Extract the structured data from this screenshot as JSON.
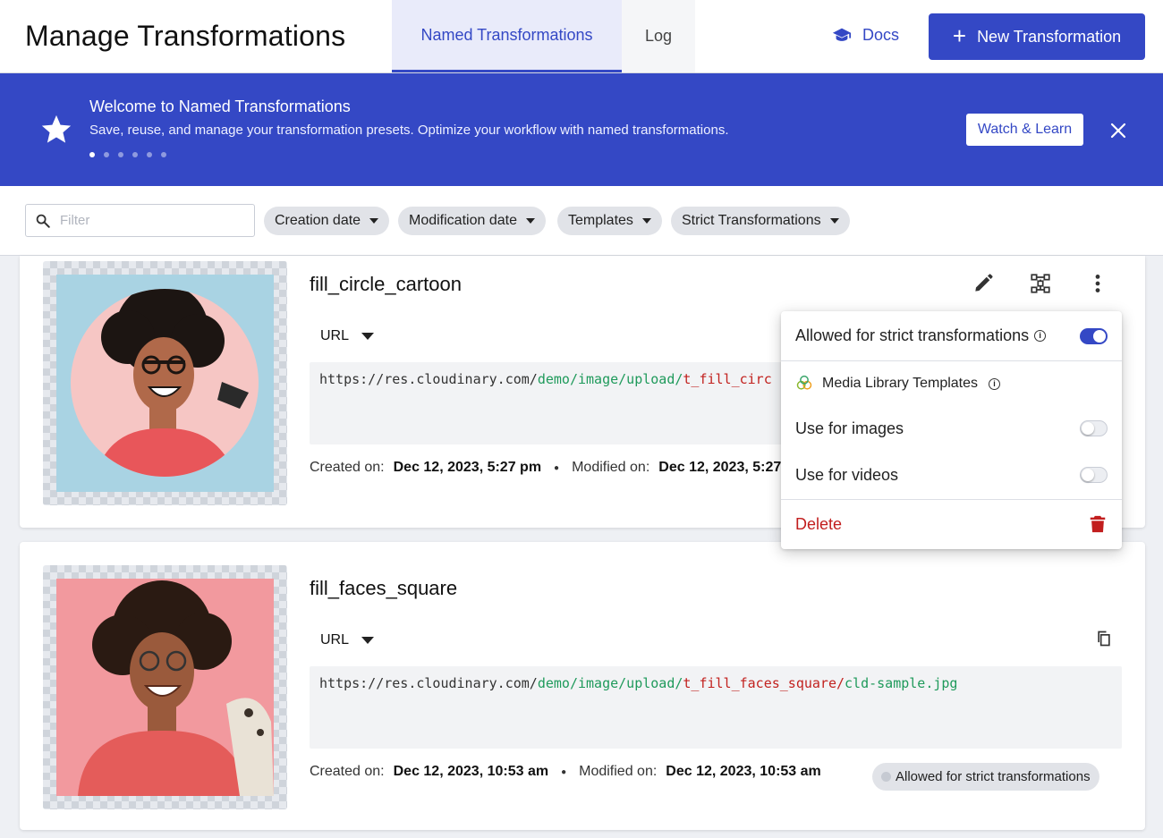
{
  "header": {
    "title": "Manage Transformations",
    "tabs": [
      {
        "label": "Named Transformations",
        "active": true
      },
      {
        "label": "Log",
        "active": false
      }
    ],
    "docs_label": "Docs",
    "docs_icon": "graduation-cap-icon",
    "new_button_label": "New Transformation"
  },
  "banner": {
    "title": "Welcome to Named Transformations",
    "text": "Save, reuse, and manage your transformation presets. Optimize your workflow with named transformations.",
    "slide_count": 6,
    "active_slide": 1,
    "watch_label": "Watch & Learn"
  },
  "filters": {
    "search_placeholder": "Filter",
    "chips": [
      "Creation date",
      "Modification date",
      "Templates",
      "Strict Transformations"
    ]
  },
  "transformations": [
    {
      "name": "fill_circle_cartoon",
      "url_type": "URL",
      "url": {
        "base": "https://res.cloudinary.com/",
        "path": "demo/image/upload/",
        "transformation": "t_fill_circ"
      },
      "created_label": "Created on:",
      "created": "Dec 12, 2023, 5:27 pm",
      "modified_label": "Modified on:",
      "modified": "Dec 12, 2023, 5:27"
    },
    {
      "name": "fill_faces_square",
      "url_type": "URL",
      "url": {
        "base": "https://res.cloudinary.com/",
        "path": "demo/image/upload/",
        "transformation": "t_fill_faces_square/",
        "file": "cld-sample.jpg"
      },
      "created_label": "Created on:",
      "created": "Dec 12, 2023, 10:53 am",
      "modified_label": "Modified on:",
      "modified": "Dec 12, 2023, 10:53 am",
      "badge": "Allowed for strict transformations"
    }
  ],
  "menu": {
    "strict_label": "Allowed for strict transformations",
    "strict_on": true,
    "templates_label": "Media Library Templates",
    "images_label": "Use for images",
    "images_on": false,
    "videos_label": "Use for videos",
    "videos_on": false,
    "delete_label": "Delete"
  },
  "colors": {
    "accent": "#3448c5",
    "danger": "#c21e1e",
    "url_path": "#1f9a5b",
    "url_transformation": "#c2221f"
  }
}
